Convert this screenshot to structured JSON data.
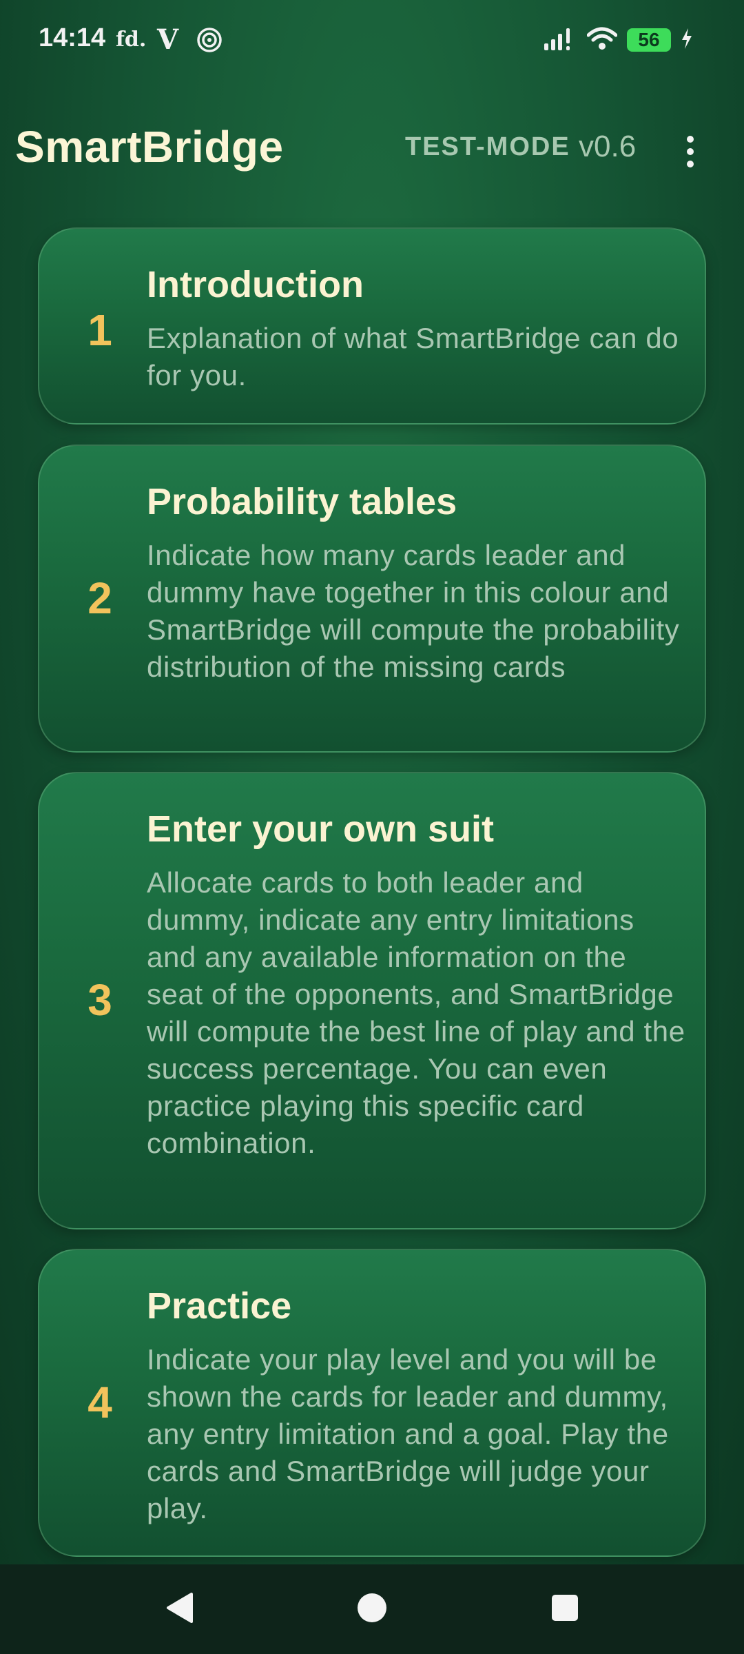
{
  "status_bar": {
    "time": "14:14",
    "notif_1": "fd.",
    "notif_2": "V",
    "battery_level": "56"
  },
  "app_bar": {
    "title": "SmartBridge",
    "mode": "TEST-MODE",
    "version": "v0.6"
  },
  "cards": [
    {
      "number": "1",
      "title": "Introduction",
      "description": "Explanation of what SmartBridge can do for you."
    },
    {
      "number": "2",
      "title": "Probability tables",
      "description": "Indicate how many cards leader and dummy have together in this colour and SmartBridge will compute the probability distribution of the missing cards"
    },
    {
      "number": "3",
      "title": "Enter your own suit",
      "description": "Allocate cards to both leader and dummy, indicate any entry limitations and any available information on the seat of the opponents, and SmartBridge will compute the best line of play and the success percentage. You can even practice playing this specific card combination."
    },
    {
      "number": "4",
      "title": "Practice",
      "description": "Indicate your play level and you will be shown the cards for leader and dummy, any entry limitation and a goal. Play the cards and SmartBridge will judge your play."
    }
  ],
  "colors": {
    "accent_number": "#f2c35c",
    "title_text": "#fbf3d2",
    "description_text": "#a9c7b2",
    "background": "#155534"
  }
}
